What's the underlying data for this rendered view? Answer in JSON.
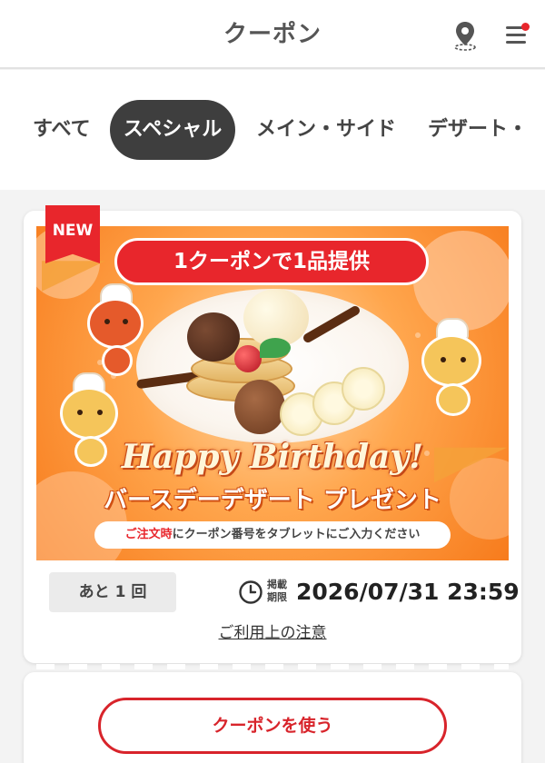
{
  "header": {
    "title": "クーポン",
    "map_icon": "map-pin-icon",
    "menu_icon": "hamburger-menu-icon",
    "notification_dot_color": "#e8262c"
  },
  "tabs": [
    {
      "label": "すべて",
      "active": false
    },
    {
      "label": "スペシャル",
      "active": true
    },
    {
      "label": "メイン・サイド",
      "active": false
    },
    {
      "label": "デザート・",
      "active": false
    }
  ],
  "coupon": {
    "badge": "NEW",
    "banner": {
      "headline": "1クーポンで1品提供",
      "script_title": "Happy Birthday!",
      "subtitle": "バースデーデザート プレゼント",
      "note_highlight": "ご注文時",
      "note_rest": "にクーポン番号をタブレットにご入力ください"
    },
    "remaining": "あと 1 回",
    "expiry_label": "掲載期限",
    "expiry_date": "2026/07/31 23:59",
    "notes_link": "ご利用上の注意",
    "use_button": "クーポンを使う"
  },
  "colors": {
    "accent_red": "#d8242b",
    "active_tab_bg": "#3e3e3e",
    "banner_orange": "#f77b1c"
  }
}
